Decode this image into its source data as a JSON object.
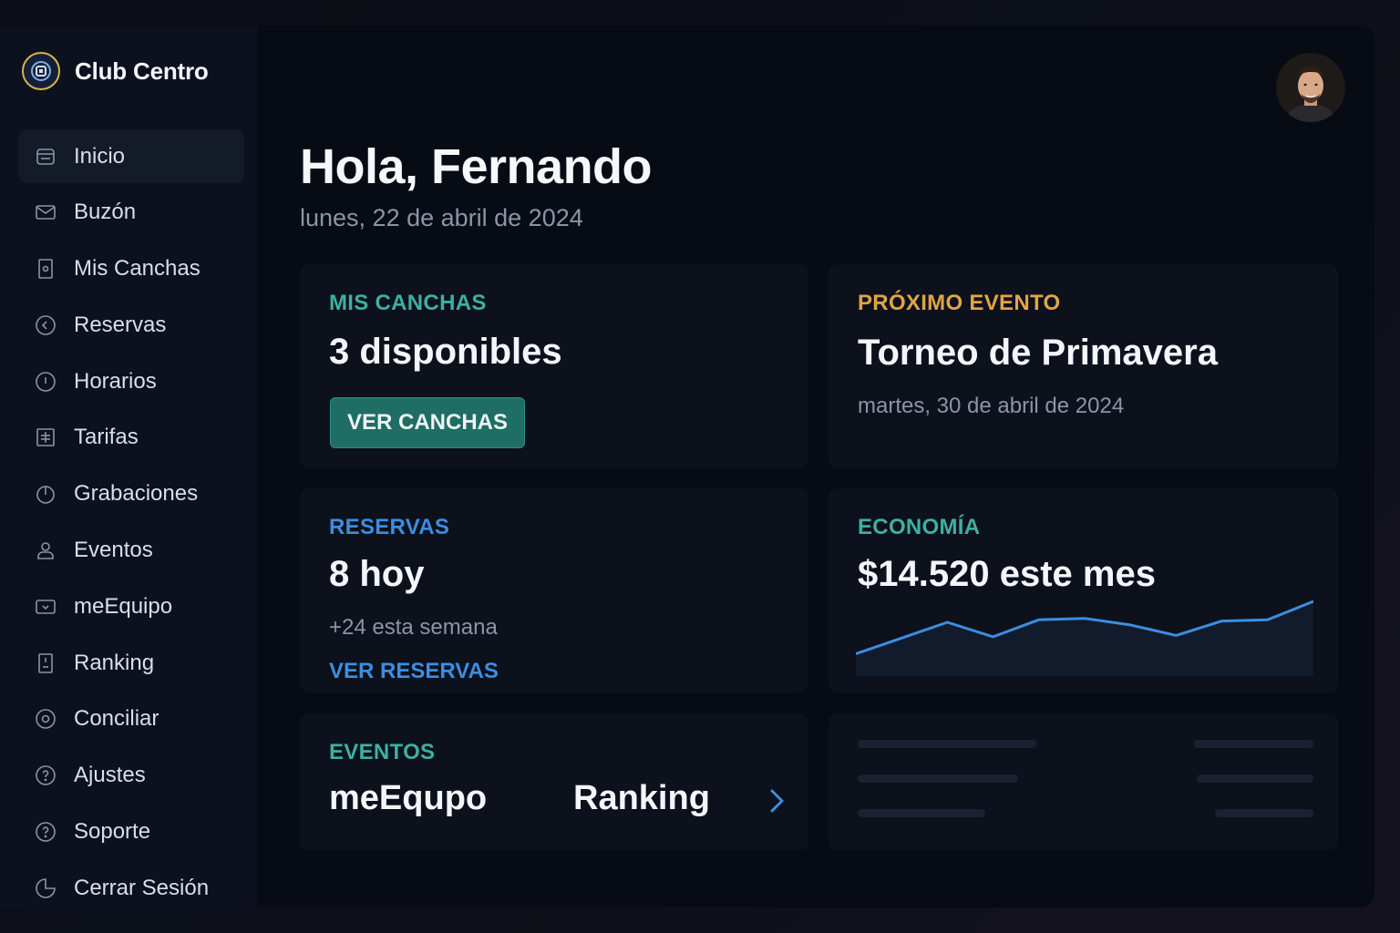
{
  "brand": {
    "name": "Club Centro",
    "logo_icon": "club-logo-icon"
  },
  "sidebar": {
    "items": [
      {
        "label": "Inicio",
        "icon": "home-icon",
        "active": true
      },
      {
        "label": "Buzón",
        "icon": "mail-icon"
      },
      {
        "label": "Mis Canchas",
        "icon": "court-icon"
      },
      {
        "label": "Reservas",
        "icon": "reservations-icon"
      },
      {
        "label": "Horarios",
        "icon": "clock-icon"
      },
      {
        "label": "Tarifas",
        "icon": "rates-icon"
      },
      {
        "label": "Grabaciones",
        "icon": "recordings-icon"
      },
      {
        "label": "Eventos",
        "icon": "user-icon"
      },
      {
        "label": "meEquipo",
        "icon": "team-icon"
      },
      {
        "label": "Ranking",
        "icon": "ranking-icon"
      },
      {
        "label": "Conciliar",
        "icon": "reconcile-icon"
      },
      {
        "label": "Ajustes",
        "icon": "help-circle-icon"
      },
      {
        "label": "Soporte",
        "icon": "support-icon"
      },
      {
        "label": "Cerrar Sesión",
        "icon": "logout-icon"
      }
    ]
  },
  "header": {
    "greeting": "Hola, Fernando",
    "date": "lunes, 22 de abril de 2024"
  },
  "cards": {
    "canchas": {
      "label": "MIS CANCHAS",
      "value": "3 disponibles",
      "button": "VER CANCHAS"
    },
    "evento": {
      "label": "PRÓXIMO EVENTO",
      "value": "Torneo de Primavera",
      "date": "martes, 30 de abril de 2024"
    },
    "reservas": {
      "label": "RESERVAS",
      "value": "8 hoy",
      "sub": "+24 esta semana",
      "link": "VER RESERVAS"
    },
    "economia": {
      "label": "ECONOMÍA",
      "value": "$14.520 este mes"
    },
    "eventos": {
      "label": "EVENTOS",
      "item1": "meEqupo",
      "item2": "Ranking"
    }
  },
  "colors": {
    "teal": "#3fb0a0",
    "amber": "#e0a545",
    "blue": "#3d8de0"
  },
  "sparkline": {
    "values": [
      1.0,
      2.2,
      3.4,
      2.3,
      3.6,
      3.7,
      3.2,
      2.4,
      3.5,
      3.6,
      5.0
    ]
  }
}
